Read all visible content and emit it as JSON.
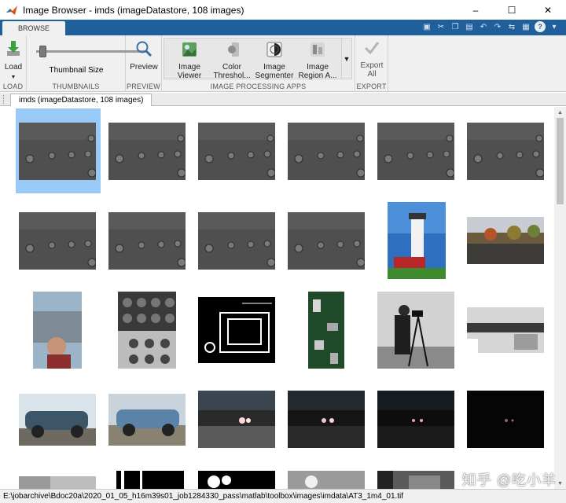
{
  "window": {
    "title": "Image Browser - imds (imageDatastore, 108 images)",
    "controls": [
      "–",
      "☐",
      "✕"
    ]
  },
  "toolstrip": {
    "active_tab": "BROWSE"
  },
  "ribbon": {
    "load": {
      "label": "Load",
      "section": "LOAD"
    },
    "thumbnails": {
      "slider_label": "Thumbnail Size",
      "section": "THUMBNAILS"
    },
    "preview": {
      "label": "Preview",
      "section": "PREVIEW"
    },
    "apps": {
      "section": "IMAGE PROCESSING APPS",
      "items": [
        {
          "line1": "Image",
          "line2": "Viewer"
        },
        {
          "line1": "Color",
          "line2": "Threshol..."
        },
        {
          "line1": "Image",
          "line2": "Segmenter"
        },
        {
          "line1": "Image",
          "line2": "Region A..."
        }
      ]
    },
    "export": {
      "line1": "Export",
      "line2": "All",
      "section": "EXPORT"
    }
  },
  "document_tab": "imds (imageDatastore, 108 images)",
  "status_path": "E:\\jobarchive\\Bdoc20a\\2020_01_05_h16m39s01_job1284330_pass\\matlab\\toolbox\\images\\imdata\\AT3_1m4_01.tif",
  "watermark": "知乎 @吃小羊",
  "colors": {
    "tab_bar": "#1f5f9b",
    "selection": "#99c9f6"
  }
}
